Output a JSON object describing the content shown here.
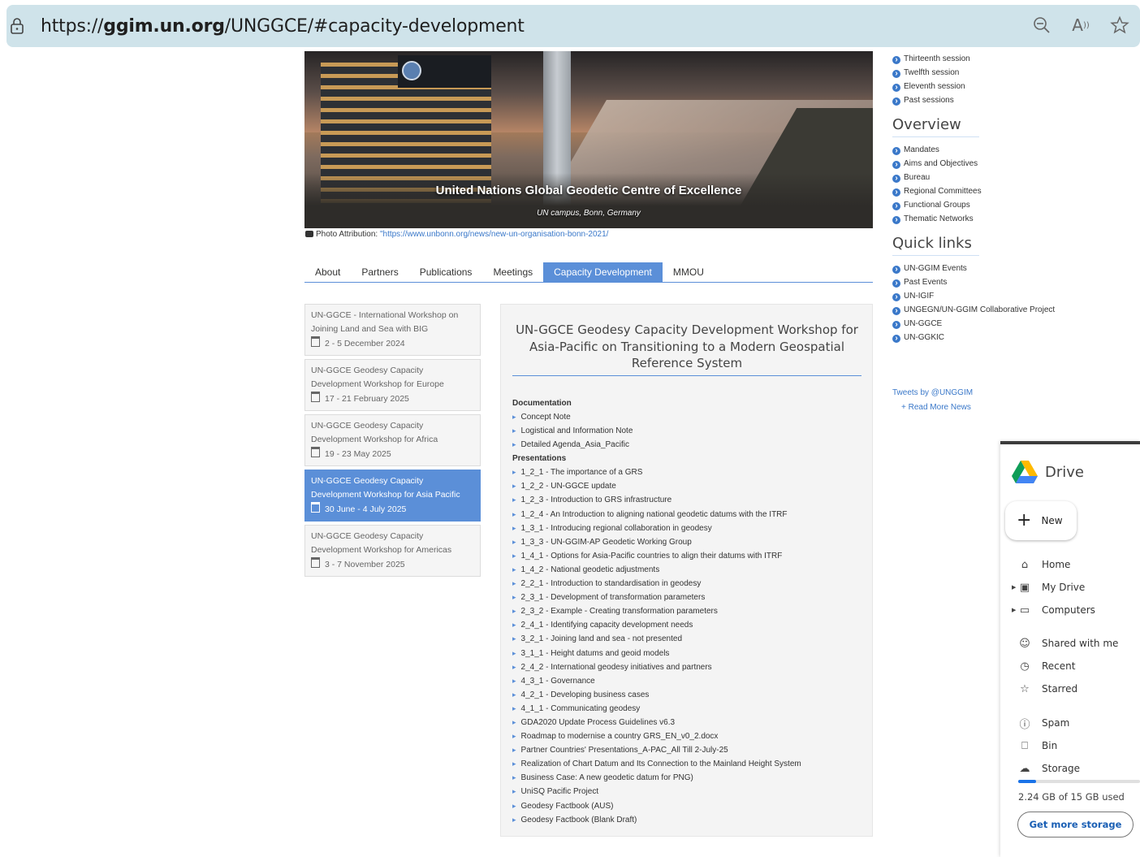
{
  "browser": {
    "url_prefix": "https://",
    "url_host": "ggim.un.org",
    "url_path": "/UNGGCE/#capacity-development"
  },
  "hero": {
    "title": "United Nations Global Geodetic Centre of Excellence",
    "subtitle": "UN campus, Bonn, Germany",
    "attribution_label": "Photo Attribution: ",
    "attribution_link": "\"https://www.unbonn.org/news/new-un-organisation-bonn-2021/"
  },
  "tabs": [
    "About",
    "Partners",
    "Publications",
    "Meetings",
    "Capacity Development",
    "MMOU"
  ],
  "active_tab": "Capacity Development",
  "workshops": [
    {
      "title": "UN-GGCE - International Workshop on Joining Land and Sea with BIG",
      "date": "2 - 5 December 2024"
    },
    {
      "title": "UN-GGCE Geodesy Capacity Development Workshop for Europe",
      "date": "17 - 21 February 2025"
    },
    {
      "title": "UN-GGCE Geodesy Capacity Development Workshop for Africa",
      "date": "19 - 23 May 2025"
    },
    {
      "title": "UN-GGCE Geodesy Capacity Development Workshop for Asia Pacific",
      "date": "30 June - 4 July 2025"
    },
    {
      "title": "UN-GGCE Geodesy Capacity Development Workshop for Americas",
      "date": "3 - 7 November 2025"
    }
  ],
  "active_workshop_index": 3,
  "panel": {
    "title": "UN-GGCE Geodesy Capacity Development Workshop for Asia-Pacific on Transitioning to a Modern Geospatial Reference System",
    "documentation_heading": "Documentation",
    "documentation": [
      "Concept Note",
      "Logistical and Information Note",
      "Detailed Agenda_Asia_Pacific"
    ],
    "presentations_heading": "Presentations",
    "presentations": [
      "1_2_1 - The importance of a GRS",
      "1_2_2 - UN-GGCE update",
      "1_2_3 - Introduction to GRS infrastructure",
      "1_2_4 - An Introduction to aligning national geodetic datums with the ITRF",
      "1_3_1 - Introducing regional collaboration in geodesy",
      "1_3_3 - UN-GGIM-AP Geodetic Working Group",
      "1_4_1 - Options for Asia-Pacific countries to align their datums with ITRF",
      "1_4_2 - National geodetic adjustments",
      "2_2_1 - Introduction to standardisation in geodesy",
      "2_3_1 - Development of transformation parameters",
      "2_3_2 - Example - Creating transformation parameters",
      "2_4_1 - Identifying capacity development needs",
      "3_2_1 - Joining land and sea - not presented",
      "3_1_1 - Height datums and geoid models",
      "2_4_2 - International geodesy initiatives and partners",
      "4_3_1 - Governance",
      "4_2_1 - Developing business cases",
      "4_1_1 - Communicating geodesy",
      "GDA2020 Update Process Guidelines v6.3",
      "Roadmap to modernise a country GRS_EN_v0_2.docx",
      "Partner Countries' Presentations_A-PAC_All Till 2-July-25",
      "Realization of Chart Datum and Its Connection to the Mainland Height System",
      "Business Case: A new geodetic datum for PNG)",
      "UniSQ Pacific Project",
      "Geodesy Factbook (AUS)",
      "Geodesy Factbook (Blank Draft)"
    ]
  },
  "sidebar": {
    "sessions": [
      "Thirteenth session",
      "Twelfth session",
      "Eleventh session",
      "Past sessions"
    ],
    "overview_heading": "Overview",
    "overview": [
      "Mandates",
      "Aims and Objectives",
      "Bureau",
      "Regional Committees",
      "Functional Groups",
      "Thematic Networks"
    ],
    "quicklinks_heading": "Quick links",
    "quicklinks": [
      "UN-GGIM Events",
      "Past Events",
      "UN-IGIF",
      "UNGEGN/UN-GGIM Collaborative Project",
      "UN-GGCE",
      "UN-GGKIC"
    ],
    "tweets": "Tweets by @UNGGIM",
    "read_more": "+ Read More News"
  },
  "drive": {
    "title": "Drive",
    "new_label": "New",
    "nav": [
      {
        "label": "Home",
        "icon": "home-icon"
      },
      {
        "label": "My Drive",
        "icon": "my-drive-icon"
      },
      {
        "label": "Computers",
        "icon": "computers-icon"
      },
      {
        "label": "Shared with me",
        "icon": "shared-icon"
      },
      {
        "label": "Recent",
        "icon": "clock-icon"
      },
      {
        "label": "Starred",
        "icon": "star-icon"
      },
      {
        "label": "Spam",
        "icon": "spam-icon"
      },
      {
        "label": "Bin",
        "icon": "bin-icon"
      },
      {
        "label": "Storage",
        "icon": "cloud-icon"
      }
    ],
    "quota_text": "2.24 GB of 15 GB used",
    "quota_fraction": 0.149,
    "get_storage_label": "Get more storage"
  }
}
